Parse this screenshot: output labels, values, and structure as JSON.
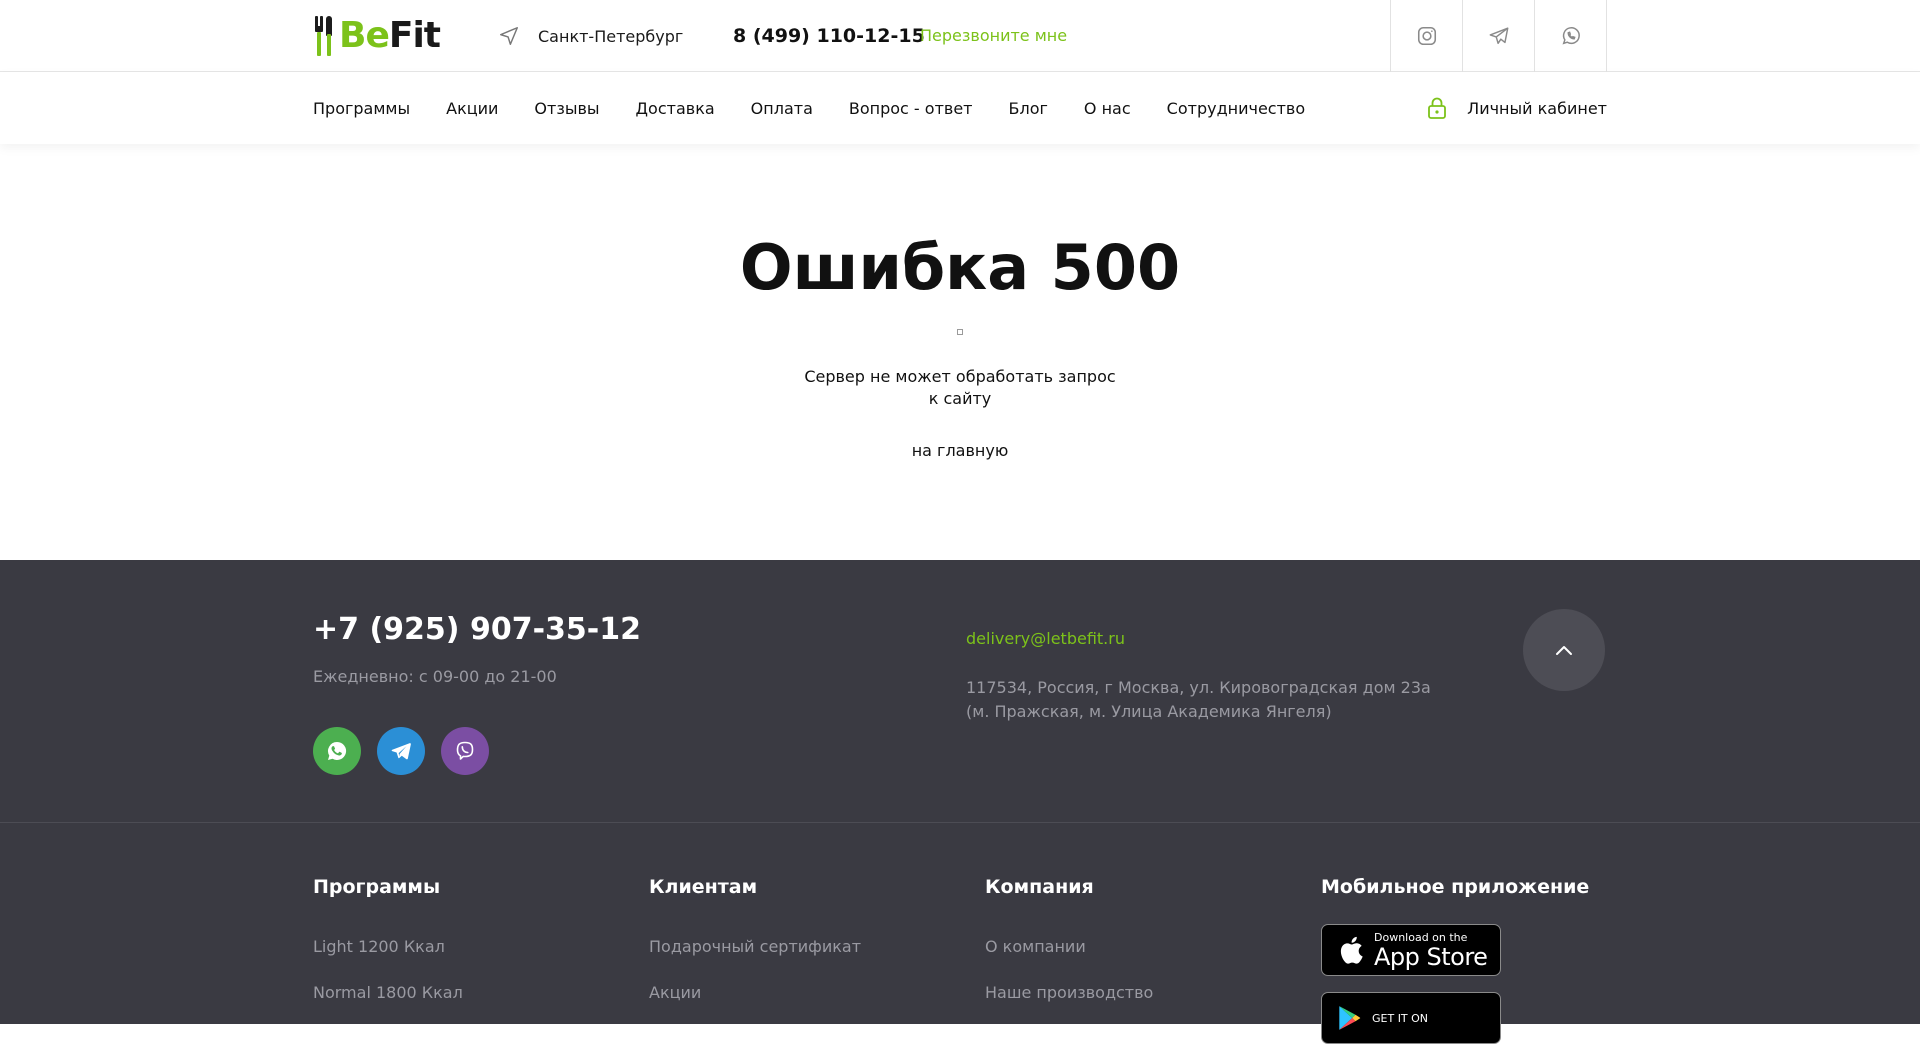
{
  "header": {
    "logo": {
      "part1": "Be",
      "part2": "Fit"
    },
    "city": "Санкт-Петербург",
    "phone": "8 (499) 110-12-15",
    "callback": "Перезвоните мне",
    "social_icons": [
      "instagram-icon",
      "telegram-icon",
      "whatsapp-icon"
    ]
  },
  "nav": {
    "items": [
      "Программы",
      "Акции",
      "Отзывы",
      "Доставка",
      "Оплата",
      "Вопрос - ответ",
      "Блог",
      "О нас",
      "Сотрудничество"
    ],
    "account": "Личный кабинет"
  },
  "error": {
    "title": "Ошибка 500",
    "message": "Сервер не может обработать запрос к сайту",
    "home_link": "на главную"
  },
  "footer": {
    "phone": "+7 (925) 907-35-12",
    "hours": "Ежедневно: с 09-00 до 21-00",
    "messengers": [
      {
        "icon": "whatsapp-icon",
        "color": "#4caf50"
      },
      {
        "icon": "telegram-icon",
        "color": "#2b8fd6"
      },
      {
        "icon": "viber-icon",
        "color": "#7b4ea3"
      }
    ],
    "email": "delivery@letbefit.ru",
    "address_line1": "117534, Россия, г Москва, ул. Кировоградская дом 23а",
    "address_line2": "(м. Пражская, м. Улица Академика Янгеля)",
    "columns": {
      "programs": {
        "title": "Программы",
        "links": [
          "Light 1200 Ккал",
          "Normal 1800 Ккал"
        ]
      },
      "clients": {
        "title": "Клиентам",
        "links": [
          "Подарочный сертификат",
          "Акции"
        ]
      },
      "company": {
        "title": "Компания",
        "links": [
          "О компании",
          "Наше производство"
        ]
      },
      "app": {
        "title": "Мобильное приложение",
        "appstore_small": "Download on the",
        "appstore_big": "App Store",
        "googleplay_small": "GET IT ON"
      }
    }
  },
  "colors": {
    "accent": "#7cc21a",
    "footer_bg": "#3a3a42"
  }
}
